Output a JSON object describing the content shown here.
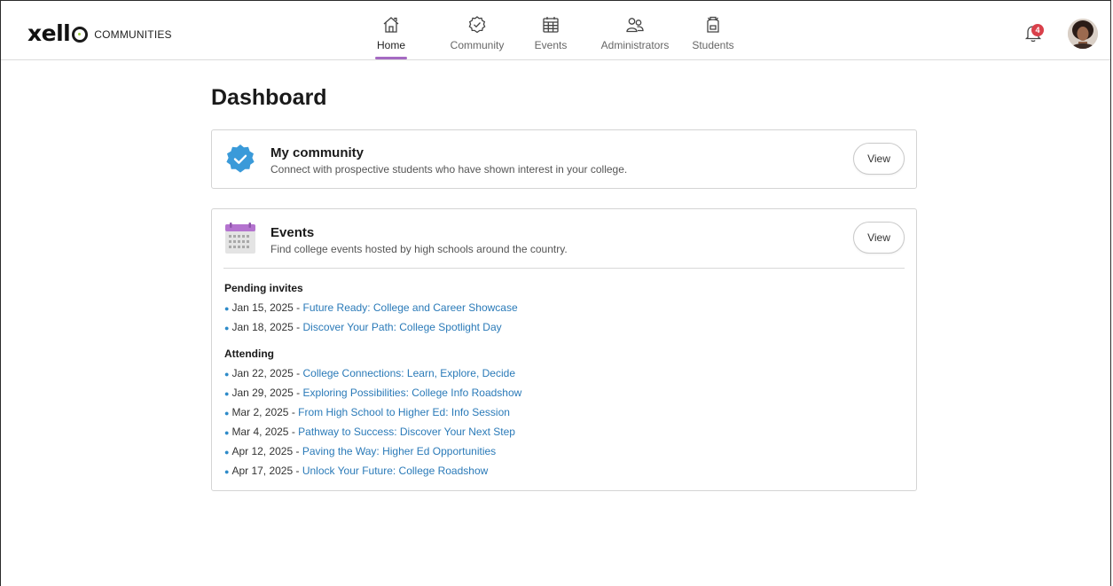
{
  "brand": {
    "wordmark_prefix": "xell",
    "suffix": "COMMUNITIES",
    "accent_dot_color": "#9ccc3d"
  },
  "nav": {
    "active_color": "#a56ac2",
    "items": [
      {
        "label": "Home",
        "icon": "home-icon",
        "active": true
      },
      {
        "label": "Community",
        "icon": "verified-badge-icon",
        "active": false
      },
      {
        "label": "Events",
        "icon": "calendar-icon",
        "active": false
      },
      {
        "label": "Administrators",
        "icon": "people-icon",
        "active": false
      },
      {
        "label": "Students",
        "icon": "backpack-icon",
        "active": false
      }
    ]
  },
  "notifications": {
    "count": "4",
    "badge_color": "#d9404a"
  },
  "page": {
    "title": "Dashboard"
  },
  "community_card": {
    "title": "My community",
    "description": "Connect with prospective students who have shown interest in your college.",
    "button": "View",
    "icon_color": "#3a9ad9"
  },
  "events_card": {
    "title": "Events",
    "description": "Find college events hosted by high schools around the country.",
    "button": "View",
    "link_color": "#2a7ab8",
    "pending": {
      "heading": "Pending invites",
      "items": [
        {
          "date": "Jan 15, 2025",
          "name": "Future Ready: College and Career Showcase"
        },
        {
          "date": "Jan 18, 2025",
          "name": "Discover Your Path: College Spotlight Day"
        }
      ]
    },
    "attending": {
      "heading": "Attending",
      "items": [
        {
          "date": "Jan 22, 2025",
          "name": "College Connections: Learn, Explore, Decide"
        },
        {
          "date": "Jan 29, 2025",
          "name": "Exploring Possibilities: College Info Roadshow"
        },
        {
          "date": "Mar 2, 2025",
          "name": "From High School to Higher Ed: Info Session"
        },
        {
          "date": "Mar 4, 2025",
          "name": "Pathway to Success: Discover Your Next Step"
        },
        {
          "date": "Apr 12, 2025",
          "name": "Paving the Way: Higher Ed Opportunities"
        },
        {
          "date": "Apr 17, 2025",
          "name": "Unlock Your Future: College Roadshow"
        }
      ]
    }
  }
}
